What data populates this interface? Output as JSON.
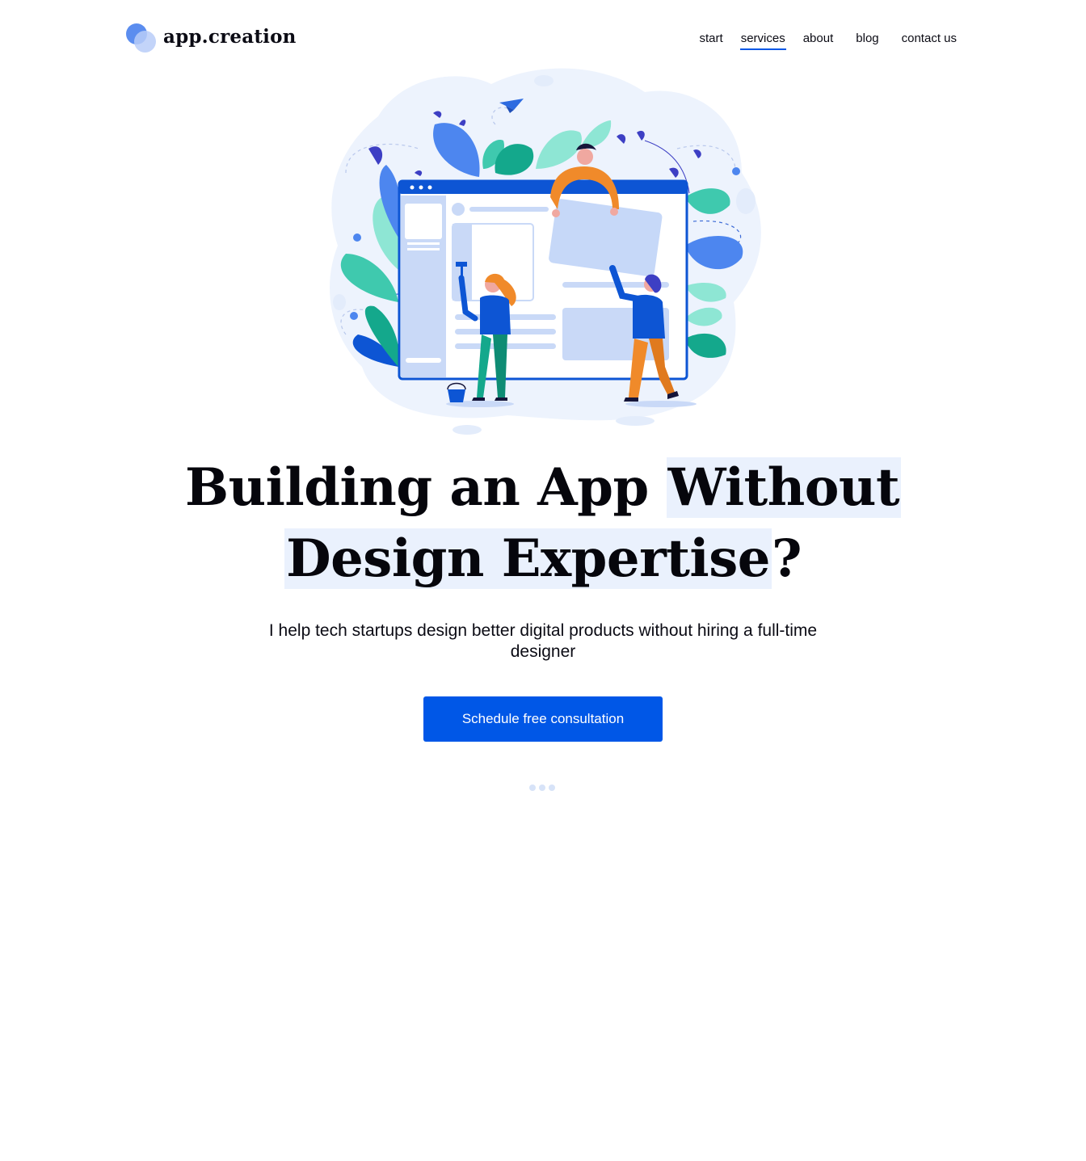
{
  "brand": {
    "name": "app.creation",
    "mark_colors": [
      "#5b8def",
      "#b8ccf8"
    ]
  },
  "nav": {
    "items": [
      {
        "label": "start",
        "active": false
      },
      {
        "label": "services",
        "active": true
      },
      {
        "label": "about",
        "active": false
      },
      {
        "label": "blog",
        "active": false
      },
      {
        "label": "contact us",
        "active": false
      }
    ]
  },
  "hero": {
    "illustration": "team-building-app-illustration",
    "headline_part1": "Building an App ",
    "headline_highlight1": "Without",
    "headline_highlight2": "Design Expertise",
    "headline_end": "?",
    "subline": "I help tech startups design better digital products without hiring a full-time designer",
    "cta_label": "Schedule free consultation",
    "scroll_indicator": "more-dots-icon"
  },
  "colors": {
    "accent": "#0057e7",
    "highlight": "#eaf1fd",
    "text": "#0b0b14",
    "blob": "#edf3fd"
  }
}
